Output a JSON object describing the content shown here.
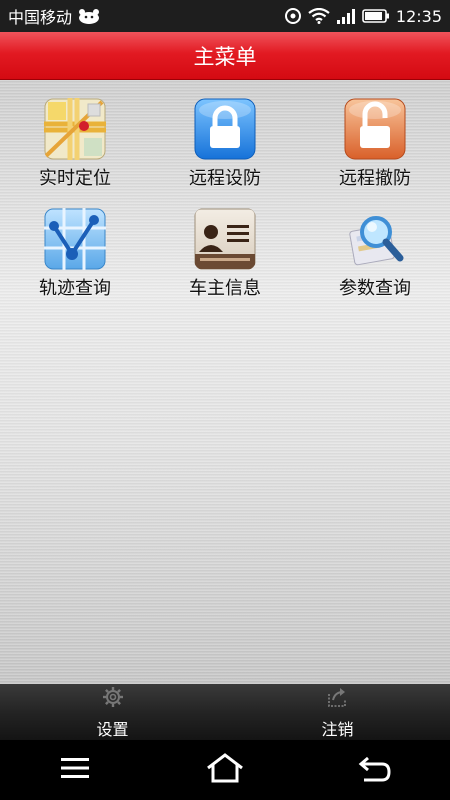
{
  "status_bar": {
    "carrier": "中国移动",
    "time": "12:35"
  },
  "header": {
    "title": "主菜单"
  },
  "menu": {
    "items": [
      {
        "label": "实时定位",
        "icon": "map-location-icon"
      },
      {
        "label": "远程设防",
        "icon": "lock-closed-icon"
      },
      {
        "label": "远程撤防",
        "icon": "lock-open-icon"
      },
      {
        "label": "轨迹查询",
        "icon": "track-route-icon"
      },
      {
        "label": "车主信息",
        "icon": "owner-card-icon"
      },
      {
        "label": "参数查询",
        "icon": "magnifier-icon"
      }
    ]
  },
  "bottom_bar": {
    "settings_label": "设置",
    "logout_label": "注销"
  },
  "colors": {
    "header_red": "#e21a22",
    "blue_lock": "#2f8fe8",
    "orange_lock": "#e87a3a"
  }
}
